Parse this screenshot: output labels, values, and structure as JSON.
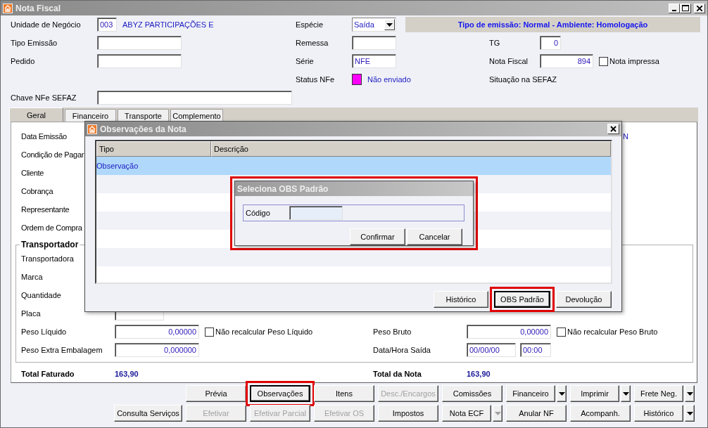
{
  "window": {
    "title": "Nota Fiscal"
  },
  "form": {
    "unidade": {
      "label": "Unidade de Negócio",
      "code": "003",
      "name": "ABYZ PARTICIPAÇÕES E"
    },
    "especie": {
      "label": "Espécie",
      "value": "Saída"
    },
    "banner": "Tipo de emissão: Normal - Ambiente: Homologação",
    "tipo_emissao": {
      "label": "Tipo Emissão"
    },
    "remessa": {
      "label": "Remessa"
    },
    "tg": {
      "label": "TG",
      "value": "0"
    },
    "pedido": {
      "label": "Pedido"
    },
    "serie": {
      "label": "Série",
      "value": "NFE"
    },
    "nota_fiscal": {
      "label": "Nota Fiscal",
      "value": "894"
    },
    "nota_impressa": {
      "label": "Nota impressa",
      "checked": false
    },
    "status_nfe": {
      "label": "Status NFe",
      "color": "#ff00ff",
      "value": "Não enviado"
    },
    "situacao_sefaz": {
      "label": "Situação na SEFAZ"
    },
    "chave": {
      "label": "Chave NFe SEFAZ"
    }
  },
  "tabs": [
    {
      "label": "Geral",
      "selected": true
    },
    {
      "label": "Financeiro",
      "selected": false
    },
    {
      "label": "Transporte",
      "selected": false
    },
    {
      "label": "Complemento",
      "selected": false
    }
  ],
  "geral": {
    "labels": [
      "Data Emissão",
      "Condição de Pagar",
      "Cliente",
      "Cobrança",
      "Representante",
      "Ordem de Compra"
    ],
    "cut_value": "N",
    "transport": {
      "title": "Transportador",
      "left": [
        {
          "label": "Transportadora",
          "kind": "label"
        },
        {
          "label": "Marca",
          "kind": "label"
        },
        {
          "label": "Quantidade",
          "kind": "label"
        },
        {
          "label": "Placa",
          "kind": "field"
        },
        {
          "label": "Peso Líquido",
          "kind": "field",
          "value": "0,00000",
          "check": {
            "label": "Não recalcular Peso Líquido",
            "checked": false
          }
        },
        {
          "label": "Peso Extra Embalagem",
          "kind": "field",
          "value": "0,000000"
        }
      ],
      "right": [
        {
          "label": "Peso Bruto",
          "kind": "field",
          "value": "0,00000",
          "check": {
            "label": "Não recalcular Peso Bruto",
            "checked": false
          }
        },
        {
          "label": "Data/Hora Saída",
          "kind": "datetime",
          "date": "00/00/00",
          "time": "00:00"
        }
      ]
    },
    "totals": [
      {
        "label": "Total Faturado",
        "value": "163,90"
      },
      {
        "label": "Total da Nota",
        "value": "163,90"
      }
    ]
  },
  "observacoes_dialog": {
    "title": "Observações da Nota",
    "columns": [
      "Tipo",
      "Descrição"
    ],
    "rows": [
      {
        "tipo": "Observação",
        "selected": true
      }
    ],
    "buttons": [
      {
        "label": "Histórico",
        "focused": false,
        "highlighted": false
      },
      {
        "label": "OBS Padrão",
        "focused": true,
        "highlighted": true
      },
      {
        "label": "Devolução",
        "focused": false,
        "highlighted": false
      }
    ]
  },
  "obs_padrao_dialog": {
    "title": "Seleciona OBS Padrão",
    "highlighted": true,
    "field_label": "Código",
    "buttons": [
      {
        "label": "Confirmar"
      },
      {
        "label": "Cancelar"
      }
    ]
  },
  "toolbar": {
    "rows": [
      [
        "",
        {
          "label": "Prévia",
          "disabled": false,
          "focused": false,
          "highlighted": false
        },
        {
          "label": "Observações",
          "disabled": false,
          "focused": true,
          "highlighted": true
        },
        {
          "label": "Itens",
          "disabled": false,
          "focused": false,
          "highlighted": false
        },
        {
          "label": "Desc./Encargos",
          "disabled": true,
          "focused": false,
          "highlighted": false
        },
        {
          "label": "Comissões",
          "disabled": false,
          "focused": false,
          "highlighted": false
        },
        {
          "label": "Financeiro",
          "disabled": false,
          "focused": false,
          "highlighted": false,
          "dropdown": {
            "disabled": false
          }
        },
        {
          "label": "Imprimir",
          "disabled": false,
          "focused": false,
          "highlighted": false,
          "dropdown": {
            "disabled": false
          }
        },
        {
          "label": "Frete Neg.",
          "disabled": false,
          "focused": false,
          "highlighted": false,
          "dropdown": {
            "disabled": false
          }
        }
      ],
      [
        {
          "label": "Consulta Serviços",
          "disabled": false,
          "focused": false,
          "highlighted": false
        },
        {
          "label": "Efetivar",
          "disabled": true,
          "focused": false,
          "highlighted": false
        },
        {
          "label": "Efetivar Parcial",
          "disabled": true,
          "focused": false,
          "highlighted": false
        },
        {
          "label": "Efetivar OS",
          "disabled": true,
          "focused": false,
          "highlighted": false
        },
        {
          "label": "Impostos",
          "disabled": false,
          "focused": false,
          "highlighted": false
        },
        {
          "label": "Nota ECF",
          "disabled": false,
          "focused": false,
          "highlighted": false,
          "dropdown": {
            "disabled": true
          }
        },
        {
          "label": "Anular NF",
          "disabled": false,
          "focused": false,
          "highlighted": false
        },
        {
          "label": "Acompanh.",
          "disabled": false,
          "focused": false,
          "highlighted": false
        },
        {
          "label": "Histórico",
          "disabled": false,
          "focused": false,
          "highlighted": false,
          "dropdown": {
            "disabled": false
          }
        }
      ]
    ]
  }
}
